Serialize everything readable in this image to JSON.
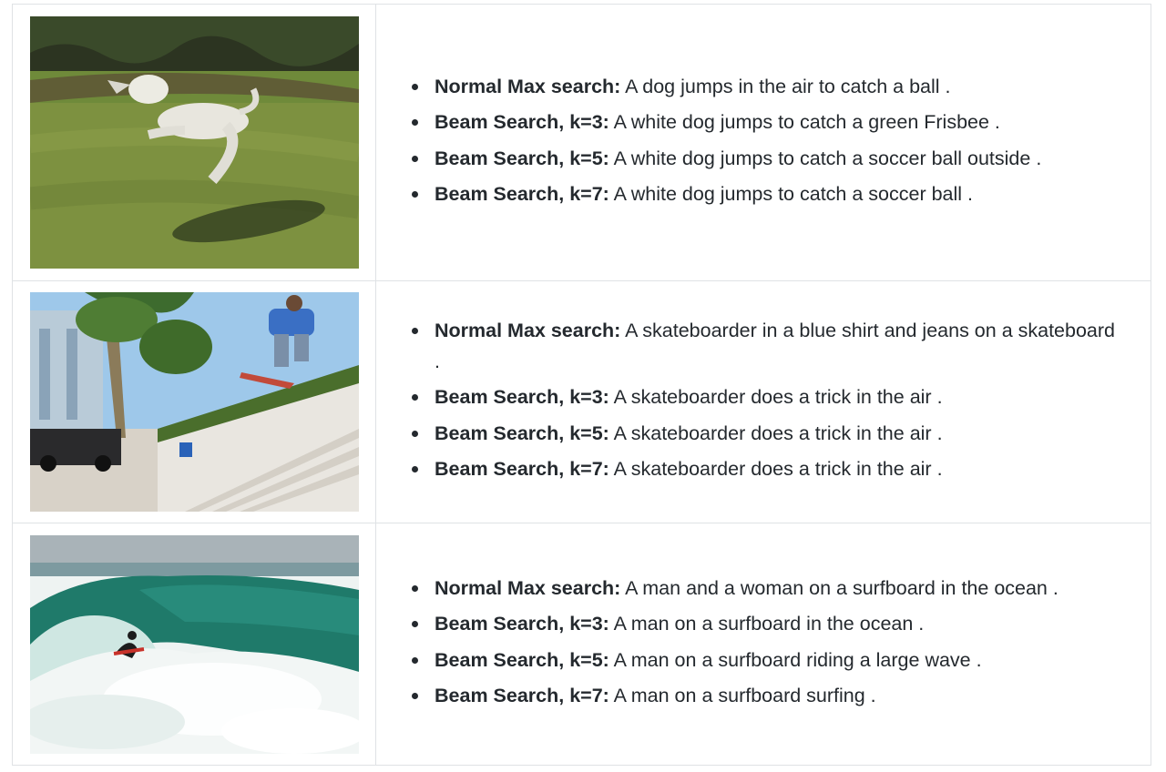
{
  "rows": [
    {
      "image": {
        "alt": "dog-frisbee-photo"
      },
      "captions": [
        {
          "method": "Normal Max search:",
          "text": "A dog jumps in the air to catch a ball ."
        },
        {
          "method": "Beam Search, k=3:",
          "text": "A white dog jumps to catch a green Frisbee ."
        },
        {
          "method": "Beam Search, k=5:",
          "text": "A white dog jumps to catch a soccer ball outside ."
        },
        {
          "method": "Beam Search, k=7:",
          "text": "A white dog jumps to catch a soccer ball ."
        }
      ]
    },
    {
      "image": {
        "alt": "skateboarder-photo"
      },
      "captions": [
        {
          "method": "Normal Max search:",
          "text": "A skateboarder in a blue shirt and jeans on a skateboard ."
        },
        {
          "method": "Beam Search, k=3:",
          "text": "A skateboarder does a trick in the air ."
        },
        {
          "method": "Beam Search, k=5:",
          "text": "A skateboarder does a trick in the air ."
        },
        {
          "method": "Beam Search, k=7:",
          "text": "A skateboarder does a trick in the air ."
        }
      ]
    },
    {
      "image": {
        "alt": "surfer-photo"
      },
      "captions": [
        {
          "method": "Normal Max search:",
          "text": "A man and a woman on a surfboard in the ocean ."
        },
        {
          "method": "Beam Search, k=3:",
          "text": "A man on a surfboard in the ocean ."
        },
        {
          "method": "Beam Search, k=5:",
          "text": "A man on a surfboard riding a large wave ."
        },
        {
          "method": "Beam Search, k=7:",
          "text": "A man on a surfboard surfing ."
        }
      ]
    }
  ],
  "colors": {
    "text": "#24292e",
    "border": "#dfe2e5",
    "grass": "#6f8a3a",
    "sky": "#9ec8ea",
    "wave": "#1f7a6a"
  }
}
